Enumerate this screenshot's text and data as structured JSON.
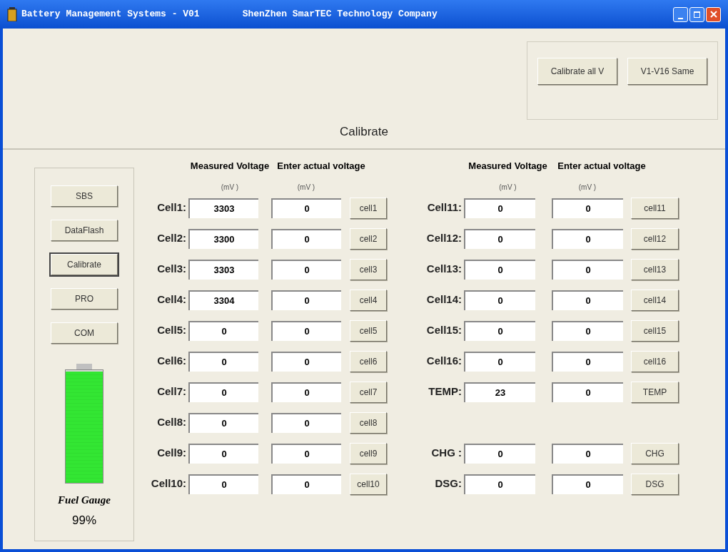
{
  "window": {
    "title": "Battery Management Systems - V01",
    "subtitle": "ShenZhen SmarTEC Technology Company"
  },
  "top_buttons": [
    "Calibrate all V",
    "V1-V16 Same"
  ],
  "section_title": "Calibrate",
  "nav": [
    {
      "label": "SBS",
      "selected": false
    },
    {
      "label": "DataFlash",
      "selected": false
    },
    {
      "label": "Calibrate",
      "selected": true
    },
    {
      "label": "PRO",
      "selected": false
    },
    {
      "label": "COM",
      "selected": false
    }
  ],
  "fuel_gauge": {
    "level": 0.99,
    "label": "Fuel Gauge",
    "percent": "99%"
  },
  "left_panel": {
    "headers": [
      "Measured Voltage",
      "Enter actual voltage"
    ],
    "units": [
      "(mV )",
      "(mV )"
    ],
    "rows": [
      {
        "label": "Cell1:",
        "measured": "3303",
        "actual": "0",
        "button": "cell1"
      },
      {
        "label": "Cell2:",
        "measured": "3300",
        "actual": "0",
        "button": "cell2"
      },
      {
        "label": "Cell3:",
        "measured": "3303",
        "actual": "0",
        "button": "cell3"
      },
      {
        "label": "Cell4:",
        "measured": "3304",
        "actual": "0",
        "button": "cell4"
      },
      {
        "label": "Cell5:",
        "measured": "0",
        "actual": "0",
        "button": "cell5"
      },
      {
        "label": "Cell6:",
        "measured": "0",
        "actual": "0",
        "button": "cell6"
      },
      {
        "label": "Cell7:",
        "measured": "0",
        "actual": "0",
        "button": "cell7"
      },
      {
        "label": "Cell8:",
        "measured": "0",
        "actual": "0",
        "button": "cell8"
      },
      {
        "label": "Cell9:",
        "measured": "0",
        "actual": "0",
        "button": "cell9"
      },
      {
        "label": "Cell10:",
        "measured": "0",
        "actual": "0",
        "button": "cell10"
      }
    ]
  },
  "right_panel": {
    "headers": [
      "Measured Voltage",
      "Enter actual voltage"
    ],
    "units": [
      "(mV )",
      "(mV )"
    ],
    "rows": [
      {
        "label": "Cell11:",
        "measured": "0",
        "actual": "0",
        "button": "cell11"
      },
      {
        "label": "Cell12:",
        "measured": "0",
        "actual": "0",
        "button": "cell12"
      },
      {
        "label": "Cell13:",
        "measured": "0",
        "actual": "0",
        "button": "cell13"
      },
      {
        "label": "Cell14:",
        "measured": "0",
        "actual": "0",
        "button": "cell14"
      },
      {
        "label": "Cell15:",
        "measured": "0",
        "actual": "0",
        "button": "cell15"
      },
      {
        "label": "Cell16:",
        "measured": "0",
        "actual": "0",
        "button": "cell16"
      },
      {
        "label": "TEMP:",
        "measured": "23",
        "actual": "0",
        "button": "TEMP"
      }
    ],
    "bottom_rows": [
      {
        "label": "CHG :",
        "measured": "0",
        "actual": "0",
        "button": "CHG"
      },
      {
        "label": "DSG:",
        "measured": "0",
        "actual": "0",
        "button": "DSG"
      }
    ]
  }
}
